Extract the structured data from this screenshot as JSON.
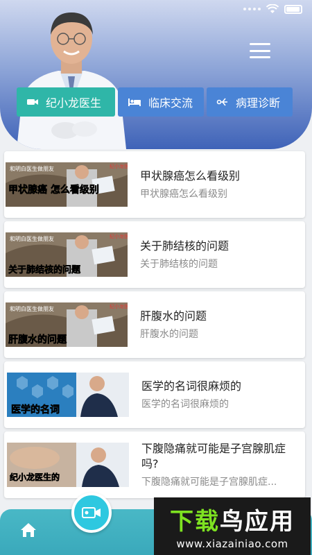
{
  "status_bar": {
    "icons": [
      "signal-dots-icon",
      "wifi-icon",
      "battery-icon"
    ]
  },
  "header": {
    "menu_icon": "hamburger-menu-icon"
  },
  "tabs": [
    {
      "label": "纪小龙医生",
      "icon": "video-camera-icon",
      "active": true
    },
    {
      "label": "临床交流",
      "icon": "bed-icon",
      "active": false
    },
    {
      "label": "病理诊断",
      "icon": "microscope-icon",
      "active": false
    }
  ],
  "articles": [
    {
      "title": "甲状腺癌怎么看级别",
      "subtitle": "甲状腺癌怎么看级别",
      "thumb_caption_top": "和明白医生做朋友",
      "thumb_caption": "甲状腺癌 怎么看级别",
      "thumb_tag": "纪小龙医生"
    },
    {
      "title": "关于肺结核的问题",
      "subtitle": "关于肺结核的问题",
      "thumb_caption_top": "和明白医生做朋友",
      "thumb_caption": "关于肺结核的问题",
      "thumb_tag": "纪小龙医生"
    },
    {
      "title": "肝腹水的问题",
      "subtitle": "肝腹水的问题",
      "thumb_caption_top": "和明白医生做朋友",
      "thumb_caption": "肝腹水的问题",
      "thumb_tag": "纪小龙医生"
    },
    {
      "title": "医学的名词很麻烦的",
      "subtitle": "医学的名词很麻烦的",
      "thumb_caption_top": "",
      "thumb_caption": "医学的名词",
      "thumb_tag": ""
    },
    {
      "title": "下腹隐痛就可能是子宫腺肌症吗?",
      "subtitle": "下腹隐痛就可能是子宫腺肌症...",
      "thumb_caption_top": "",
      "thumb_caption": "纪小龙医生的",
      "thumb_tag": ""
    }
  ],
  "bottom_nav": {
    "home_icon": "home-icon",
    "center_icon": "video-icon"
  },
  "watermark": {
    "brand_green": "下载",
    "brand_white": "鸟应用",
    "url": "www.xiazainiao.com"
  },
  "colors": {
    "header_top": "#cfd8ef",
    "header_bottom": "#3f63b8",
    "tab_active": "#2fb6a8",
    "tab": "#4a84d6",
    "nav": "#44b4c4",
    "fab": "#2ec8e0",
    "wm_green": "#7ee321"
  }
}
